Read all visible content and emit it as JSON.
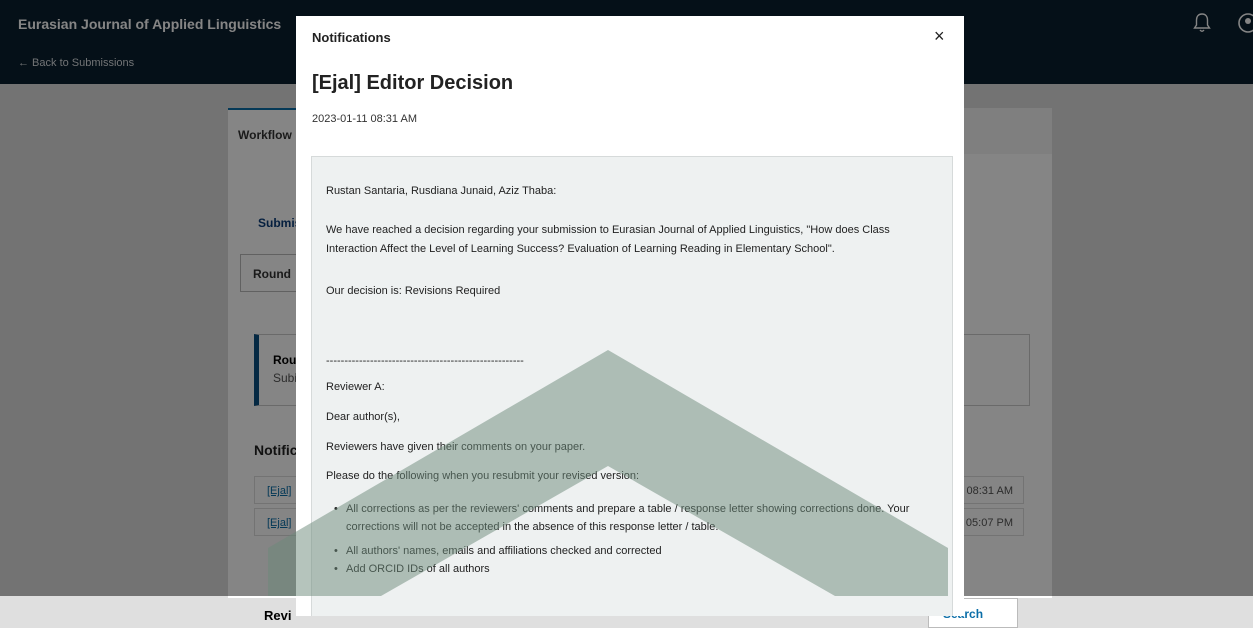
{
  "topbar": {
    "journal": "Eurasian Journal of Applied Linguistics",
    "back": "← Back to Submissions"
  },
  "background": {
    "workflow_tab": "Workflow",
    "stage_tab": "Submis",
    "round_tab": "Round",
    "infobox_line1": "Rou",
    "infobox_line2": "Subi",
    "notifications_heading": "Notific",
    "notification_rows": [
      {
        "link": "[Ejal]",
        "date": "08:31 AM"
      },
      {
        "link": "[Ejal]",
        "date": "05:07 PM"
      }
    ],
    "reviews_heading": "Revi",
    "search_button": "Search"
  },
  "modal": {
    "header": "Notifications",
    "close": "×",
    "title": "[Ejal] Editor Decision",
    "date": "2023-01-11 08:31 AM",
    "message": {
      "recipients": "Rustan Santaria, Rusdiana Junaid, Aziz Thaba:",
      "paragraph1": "We have reached a decision regarding your submission to Eurasian Journal of Applied Linguistics, \"How does Class Interaction Affect the Level of Learning Success? Evaluation of Learning Reading in Elementary School\".",
      "decision": "Our decision is: Revisions Required",
      "separator": "------------------------------------------------------",
      "reviewer": "Reviewer A:",
      "greeting": "Dear author(s),",
      "line1": "Reviewers have given their comments on your paper.",
      "line2": "Please do the following when you resubmit your revised version:",
      "bullets": [
        "All corrections as per the reviewers' comments and prepare a table / response letter showing corrections done. Your corrections will not be accepted in the absence of this response letter / table.",
        "All authors' names, emails and affiliations checked and corrected",
        "Add ORCID IDs of all authors"
      ]
    }
  },
  "colors": {
    "topbar": "#0b1f2e",
    "accent": "#0b6ea8",
    "watermark": "#6b8a7a"
  }
}
